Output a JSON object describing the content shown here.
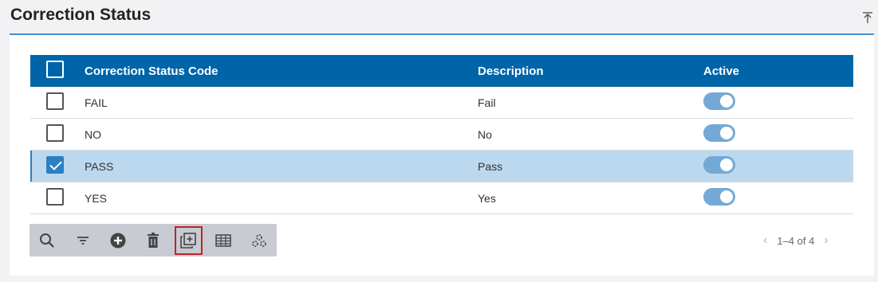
{
  "header": {
    "title": "Correction Status"
  },
  "grid": {
    "columns": [
      "Correction Status Code",
      "Description",
      "Active"
    ],
    "rows": [
      {
        "code": "FAIL",
        "description": "Fail",
        "active": true,
        "selected": false
      },
      {
        "code": "NO",
        "description": "No",
        "active": true,
        "selected": false
      },
      {
        "code": "PASS",
        "description": "Pass",
        "active": true,
        "selected": true
      },
      {
        "code": "YES",
        "description": "Yes",
        "active": true,
        "selected": false
      }
    ]
  },
  "toolbar": {
    "buttons": [
      "search-icon",
      "filter-icon",
      "add-icon",
      "delete-icon",
      "copy-icon",
      "grid-view-icon",
      "settings-icon"
    ],
    "focused": "copy-icon"
  },
  "pager": {
    "range": "1–4 of 4"
  },
  "colors": {
    "header_bg": "#0064a8",
    "selected_row": "#bcd8ee",
    "toggle": "#74a9d6",
    "accent_line": "#3d8fd6",
    "focus_outline": "#c0232c"
  }
}
